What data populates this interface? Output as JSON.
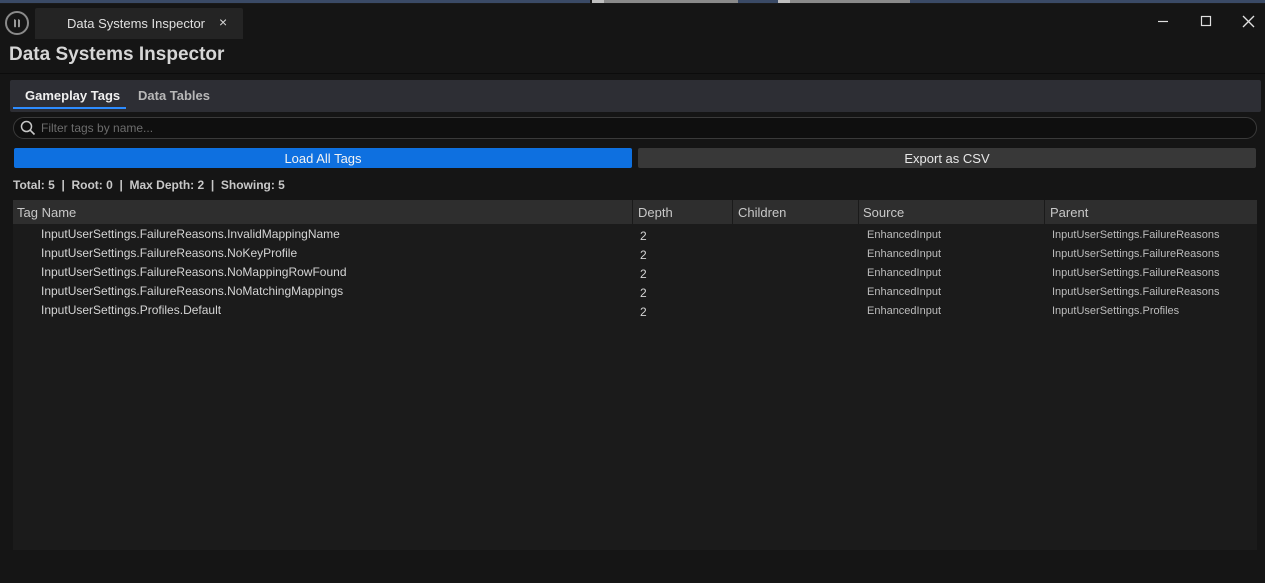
{
  "window": {
    "tab_title": "Data Systems Inspector",
    "tab_close": "×",
    "controls": [
      "minimize-icon",
      "maximize-icon",
      "close-icon"
    ]
  },
  "page": {
    "title": "Data Systems Inspector"
  },
  "tabs": [
    {
      "label": "Gameplay Tags",
      "active": true
    },
    {
      "label": "Data Tables",
      "active": false
    }
  ],
  "search": {
    "placeholder": "Filter tags by name...",
    "value": "",
    "icon": "search-icon"
  },
  "actions": {
    "load_label": "Load All Tags",
    "export_label": "Export as CSV"
  },
  "stats": "Total: 5  |  Root: 0  |  Max Depth: 2  |  Showing: 5",
  "table": {
    "columns": [
      "Tag Name",
      "Depth",
      "Children",
      "Source",
      "Parent"
    ],
    "rows": [
      {
        "name": "InputUserSettings.FailureReasons.InvalidMappingName",
        "depth": "2",
        "children": "",
        "source": "EnhancedInput",
        "parent": "InputUserSettings.FailureReasons"
      },
      {
        "name": "InputUserSettings.FailureReasons.NoKeyProfile",
        "depth": "2",
        "children": "",
        "source": "EnhancedInput",
        "parent": "InputUserSettings.FailureReasons"
      },
      {
        "name": "InputUserSettings.FailureReasons.NoMappingRowFound",
        "depth": "2",
        "children": "",
        "source": "EnhancedInput",
        "parent": "InputUserSettings.FailureReasons"
      },
      {
        "name": "InputUserSettings.FailureReasons.NoMatchingMappings",
        "depth": "2",
        "children": "",
        "source": "EnhancedInput",
        "parent": "InputUserSettings.FailureReasons"
      },
      {
        "name": "InputUserSettings.Profiles.Default",
        "depth": "2",
        "children": "",
        "source": "EnhancedInput",
        "parent": "InputUserSettings.Profiles"
      }
    ]
  },
  "colors": {
    "accent": "#0e70e0",
    "tab_underline": "#2d8cff",
    "background": "#151515"
  }
}
